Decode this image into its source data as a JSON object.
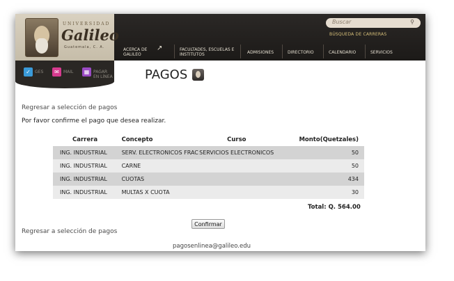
{
  "header": {
    "logo": {
      "university": "UNIVERSIDAD",
      "name": "Galileo",
      "location": "Guatemala, C. A."
    },
    "search": {
      "placeholder": "Buscar",
      "careers_link": "BÚSQUEDA DE CARRERAS"
    },
    "nav": [
      {
        "label": "ACERCA DE GALILEO"
      },
      {
        "label": "FACULTADES, ESCUELAS E INSTITUTOS"
      },
      {
        "label": "ADMISIONES"
      },
      {
        "label": "DIRECTORIO"
      },
      {
        "label": "CALENDARIO"
      },
      {
        "label": "SERVICIOS"
      }
    ]
  },
  "side": {
    "ges": {
      "label": "GES",
      "color": "#3a9ad9"
    },
    "mail": {
      "label": "MAIL",
      "color": "#d63b8f"
    },
    "pay": {
      "label": "PAGAR EN LÍNEA",
      "color": "#9a4bc4"
    }
  },
  "page": {
    "title": "PAGOS",
    "back_link_top": "Regresar a selección de pagos",
    "instruction": "Por favor confirme el pago que desea realizar.",
    "table": {
      "headers": [
        "Carrera",
        "Concepto",
        "Curso",
        "Monto(Quetzales)"
      ],
      "rows": [
        [
          "ING. INDUSTRIAL",
          "SERV. ELECTRONICOS FRAC",
          "SERVICIOS ELECTRONICOS",
          "50"
        ],
        [
          "ING. INDUSTRIAL",
          "CARNE",
          "",
          "50"
        ],
        [
          "ING. INDUSTRIAL",
          "CUOTAS",
          "",
          "434"
        ],
        [
          "ING. INDUSTRIAL",
          "MULTAS X CUOTA",
          "",
          "30"
        ]
      ]
    },
    "total": "Total: Q. 564.00",
    "confirm_button": "Confirmar",
    "back_link_bottom": "Regresar a selección de pagos",
    "footer_email": "pagosenlinea@galileo.edu"
  }
}
